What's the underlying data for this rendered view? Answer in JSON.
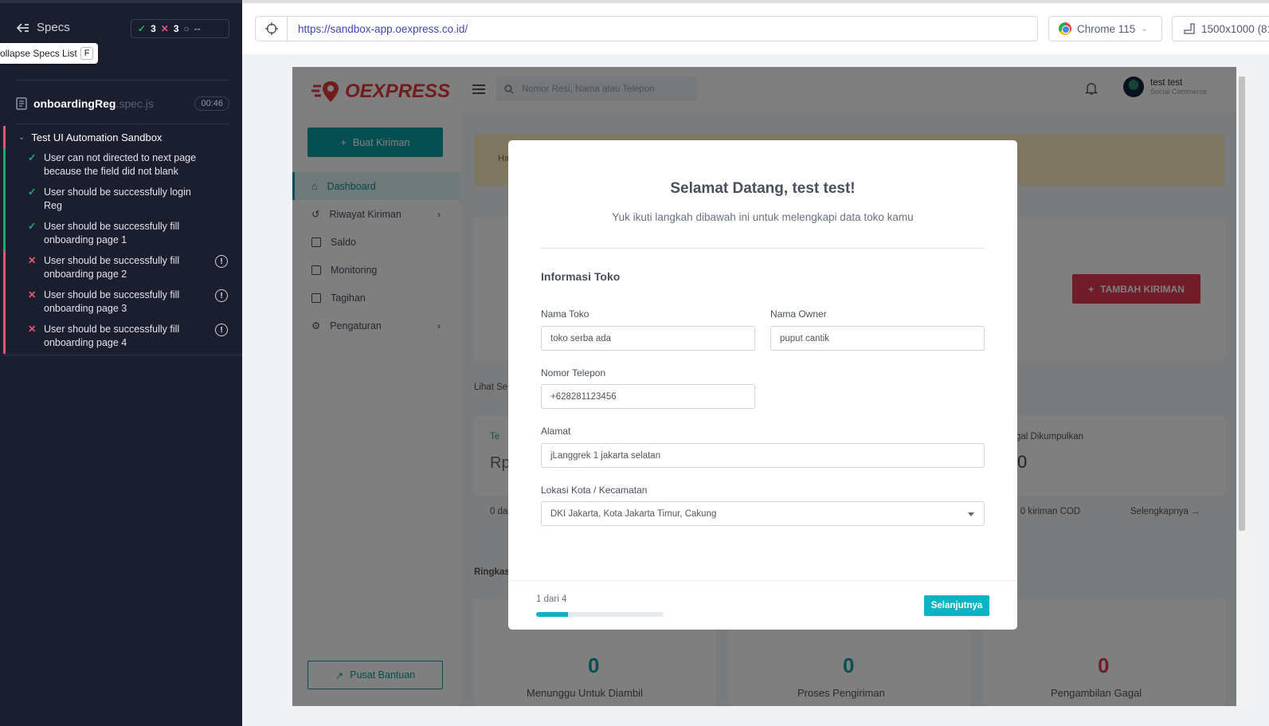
{
  "runner": {
    "specs_label": "Specs",
    "stats": {
      "passed": "3",
      "failed": "3",
      "pending": "--"
    },
    "tooltip": {
      "text": "ollapse Specs List",
      "key": "F"
    },
    "spec_file": {
      "name": "onboardingReg",
      "ext": ".spec.js",
      "duration": "00:46"
    },
    "suite": {
      "title": "Test UI Automation Sandbox",
      "tests": [
        {
          "title": "User can not directed to next page because the field did not blank",
          "state": "pass"
        },
        {
          "title": "User should be successfully login Reg",
          "state": "pass"
        },
        {
          "title": "User should be successfully fill onboarding page 1",
          "state": "pass"
        },
        {
          "title": "User should be successfully fill onboarding page 2",
          "state": "fail"
        },
        {
          "title": "User should be successfully fill onboarding page 3",
          "state": "fail"
        },
        {
          "title": "User should be successfully fill onboarding page 4",
          "state": "fail"
        }
      ]
    }
  },
  "browser": {
    "url": "https://sandbox-app.oexpress.co.id/",
    "name": "Chrome 115",
    "viewport": "1500x1000 (81"
  },
  "app": {
    "logo": "OEXPRESS",
    "create_button": "Buat Kiriman",
    "nav": [
      {
        "label": "Dashboard",
        "icon": "home-icon",
        "active": true
      },
      {
        "label": "Riwayat Kiriman",
        "icon": "history-icon",
        "chevron": true
      },
      {
        "label": "Saldo",
        "icon": "wallet-icon"
      },
      {
        "label": "Monitoring",
        "icon": "calendar-icon"
      },
      {
        "label": "Tagihan",
        "icon": "invoice-icon"
      },
      {
        "label": "Pengaturan",
        "icon": "gear-icon",
        "chevron": true
      }
    ],
    "help_button": "Pusat Bantuan",
    "search_placeholder": "Nomor Resi, Nama atau Telepon",
    "user": {
      "name": "test test",
      "role": "Social Commerce"
    },
    "banner_text": "Ha",
    "tambah_button": "TAMBAH KIRIMAN",
    "background": {
      "lihat": "Lihat Sel",
      "te": "Te",
      "rp": "Rp",
      "dikumpulkan": "gal Dikumpulkan",
      "zero_top": "0",
      "dari": "0 dar",
      "cod": "i 0 kiriman COD",
      "selengkapnya": "Selengkapnya",
      "ringkasan": "Ringkasa",
      "stats": [
        {
          "value": "0",
          "label": "Menunggu Untuk Diambil"
        },
        {
          "value": "0",
          "label": "Proses Pengiriman"
        },
        {
          "value": "0",
          "label": "Pengambilan Gagal"
        }
      ]
    }
  },
  "modal": {
    "title": "Selamat Datang, test test!",
    "subtitle": "Yuk ikuti langkah dibawah ini untuk melengkapi data toko kamu",
    "section": "Informasi Toko",
    "fields": {
      "nama_toko": {
        "label": "Nama Toko",
        "value": "toko serba ada"
      },
      "nama_owner": {
        "label": "Nama Owner",
        "value": "puput cantik"
      },
      "telepon": {
        "label": "Nomor Telepon",
        "value": "+628281123456"
      },
      "alamat": {
        "label": "Alamat",
        "value": "jLanggrek 1 jakarta selatan"
      },
      "lokasi": {
        "label": "Lokasi Kota / Kecamatan",
        "value": "DKI Jakarta, Kota Jakarta Timur, Cakung"
      }
    },
    "step": "1 dari 4",
    "progress": 0.25,
    "next_button": "Selanjutnya"
  },
  "colors": {
    "teal": "#0b9ea4",
    "red": "#e23b52",
    "cyan": "#0bb3c4",
    "runner_bg": "#1b1e2e"
  }
}
